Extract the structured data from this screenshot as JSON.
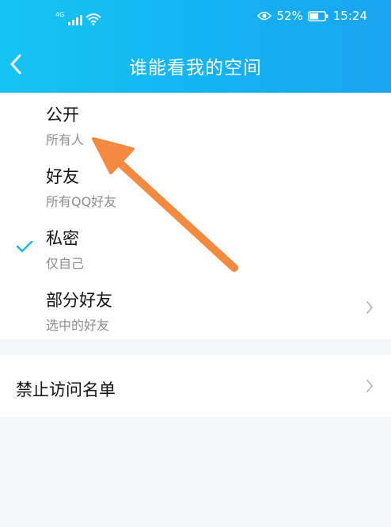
{
  "statusbar": {
    "network": "4G",
    "battery": "52%",
    "time": "15:24"
  },
  "header": {
    "title": "谁能看我的空间"
  },
  "options": [
    {
      "title": "公开",
      "subtitle": "所有人",
      "selected": false
    },
    {
      "title": "好友",
      "subtitle": "所有QQ好友",
      "selected": false
    },
    {
      "title": "私密",
      "subtitle": "仅自己",
      "selected": true
    },
    {
      "title": "部分好友",
      "subtitle": "选中的好友",
      "selected": false
    }
  ],
  "blacklist": {
    "label": "禁止访问名单"
  },
  "colors": {
    "header_start": "#16c4f2",
    "header_end": "#1aa5f0",
    "check": "#1ab5f0",
    "annotation_arrow": "#f38a3f",
    "background": "#f5f6fa"
  },
  "icons": [
    "back-icon",
    "eye-icon",
    "battery-icon",
    "wifi-icon",
    "signal-icon",
    "check-icon",
    "chevron-right-icon",
    "annotation-arrow"
  ]
}
